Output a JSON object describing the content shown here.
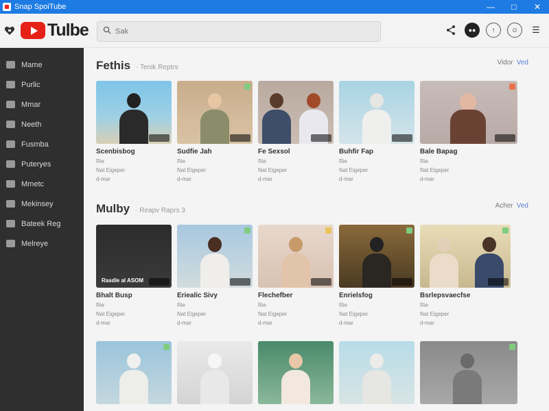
{
  "window": {
    "title": "Snap SpoiTube"
  },
  "header": {
    "logo_text": "Tulbe",
    "search_placeholder": "Sak"
  },
  "sidebar": {
    "items": [
      {
        "label": "Mame"
      },
      {
        "label": "Purlic"
      },
      {
        "label": "Mmar"
      },
      {
        "label": "Neeth"
      },
      {
        "label": "Fusmba"
      },
      {
        "label": "Puteryes"
      },
      {
        "label": "Mmetc"
      },
      {
        "label": "Mekinsey"
      },
      {
        "label": "Bateek Reg"
      },
      {
        "label": "Melreye"
      }
    ]
  },
  "sections": [
    {
      "title": "Fethis",
      "subtitle": "· Tenik Reptrs",
      "action": "Vidor",
      "action_more": "Ved",
      "cards": [
        {
          "title": "Scenbisbog",
          "meta1": "Rie",
          "meta2": "Nat Eigeper",
          "meta3": "d-mar"
        },
        {
          "title": "Sudfie Jah",
          "meta1": "Rie",
          "meta2": "Nat Eigeper",
          "meta3": "d-mar"
        },
        {
          "title": "Fe Sexsol",
          "meta1": "Rie",
          "meta2": "Nat Eigeper",
          "meta3": "d-mar"
        },
        {
          "title": "Buhfir Fap",
          "meta1": "Rie",
          "meta2": "Nat Eigeper",
          "meta3": "d-mar"
        },
        {
          "title": "Bale Bapag",
          "meta1": "Rie",
          "meta2": "Nat Eigeper",
          "meta3": "d-mar"
        }
      ]
    },
    {
      "title": "Mulby",
      "subtitle": "· Reapv Raprs 3",
      "action": "Acher",
      "action_more": "Ved",
      "cards": [
        {
          "title": "Bhalt Busp",
          "meta1": "Rie",
          "meta2": "Nat Eigeper",
          "meta3": "d-mar",
          "overlay": "Rasdle al ASOM"
        },
        {
          "title": "Eriealic Sivy",
          "meta1": "Rie",
          "meta2": "Nat Eigeper",
          "meta3": "d-mar"
        },
        {
          "title": "Flechefber",
          "meta1": "Rie",
          "meta2": "Nat Eigeper",
          "meta3": "d-mar"
        },
        {
          "title": "Enrielsfog",
          "meta1": "Rie",
          "meta2": "Nat Eigeper",
          "meta3": "d-mar"
        },
        {
          "title": "Bsrlepsvaecfse",
          "meta1": "Rie",
          "meta2": "Nat Eigeper",
          "meta3": "d-mar"
        }
      ]
    },
    {
      "cards": [
        {},
        {},
        {},
        {},
        {}
      ]
    }
  ],
  "icons": {
    "share": "share-icon",
    "cast": "cast-icon",
    "upload": "upload-icon",
    "account": "account-icon",
    "menu": "menu-icon"
  },
  "colors": {
    "titlebar": "#1e7be3",
    "brand_red": "#e62117",
    "sidebar": "#2f2f2f",
    "link": "#5a7fd6"
  }
}
